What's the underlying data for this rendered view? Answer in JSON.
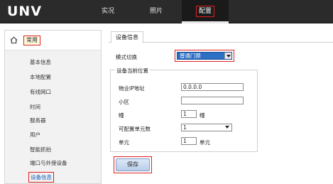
{
  "header": {
    "logo": "UNV",
    "tabs": [
      {
        "label": "实况"
      },
      {
        "label": "照片"
      },
      {
        "label": "配置"
      }
    ]
  },
  "sidebar": {
    "category": "常用",
    "items": [
      {
        "label": "基本信息"
      },
      {
        "label": "本地配置"
      },
      {
        "label": "有线网口"
      },
      {
        "label": "时间"
      },
      {
        "label": "服务器"
      },
      {
        "label": "用户"
      },
      {
        "label": "智能抓拍"
      },
      {
        "label": "端口与外接设备"
      },
      {
        "label": "设备信息"
      }
    ],
    "active_index": 8
  },
  "main": {
    "tab": "设备信息",
    "mode_label": "模式切换",
    "mode_value": "普通门禁",
    "group_title": "设备当前位置",
    "fields": {
      "ip_label": "物业IP地址",
      "ip_value": "0.0.0.0",
      "community_label": "小区",
      "community_value": "",
      "building_label": "幢",
      "building_value": "1",
      "building_unit": "幢",
      "config_units_label": "可配置单元数",
      "config_units_value": "1",
      "unit_label": "单元",
      "unit_value": "1",
      "unit_suffix": "单元"
    },
    "save_label": "保存"
  },
  "colors": {
    "topbar": "#2b2b2b",
    "highlight": "#e02020",
    "select_blue": "#2d6fc4",
    "active_link": "#1a5fb4"
  }
}
